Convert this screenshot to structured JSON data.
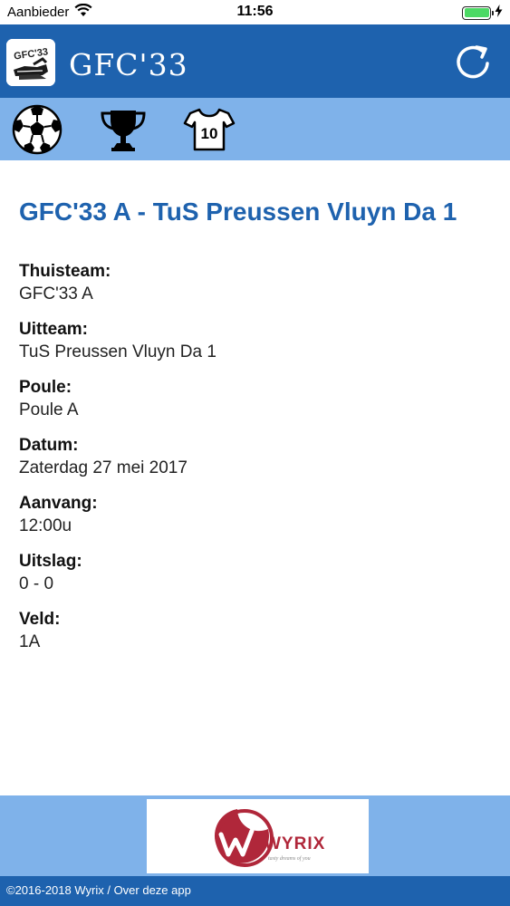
{
  "status_bar": {
    "carrier": "Aanbieder",
    "time": "11:56",
    "battery_percent": 100
  },
  "header": {
    "title": "GFC'33",
    "logo_text": "GFC'33",
    "refresh_icon": "refresh-icon"
  },
  "tabs": [
    {
      "icon": "soccer-ball-icon"
    },
    {
      "icon": "trophy-icon"
    },
    {
      "icon": "jersey-icon",
      "number": "10"
    }
  ],
  "match": {
    "title": "GFC'33 A - TuS Preussen Vluyn Da 1",
    "fields": [
      {
        "label": "Thuisteam:",
        "value": "GFC'33 A"
      },
      {
        "label": "Uitteam:",
        "value": "TuS Preussen Vluyn Da 1"
      },
      {
        "label": "Poule:",
        "value": "Poule A"
      },
      {
        "label": "Datum:",
        "value": "Zaterdag 27 mei 2017"
      },
      {
        "label": "Aanvang:",
        "value": "12:00u"
      },
      {
        "label": "Uitslag:",
        "value": "0 - 0"
      },
      {
        "label": "Veld:",
        "value": "1A"
      }
    ]
  },
  "sponsor": {
    "name": "WYRIX",
    "tagline": "tasty dreams of you"
  },
  "footer": {
    "text": "©2016-2018 Wyrix / Over deze app"
  },
  "colors": {
    "primary": "#1e62ae",
    "secondary": "#7fb2ea",
    "sponsor_red": "#b0273a"
  }
}
